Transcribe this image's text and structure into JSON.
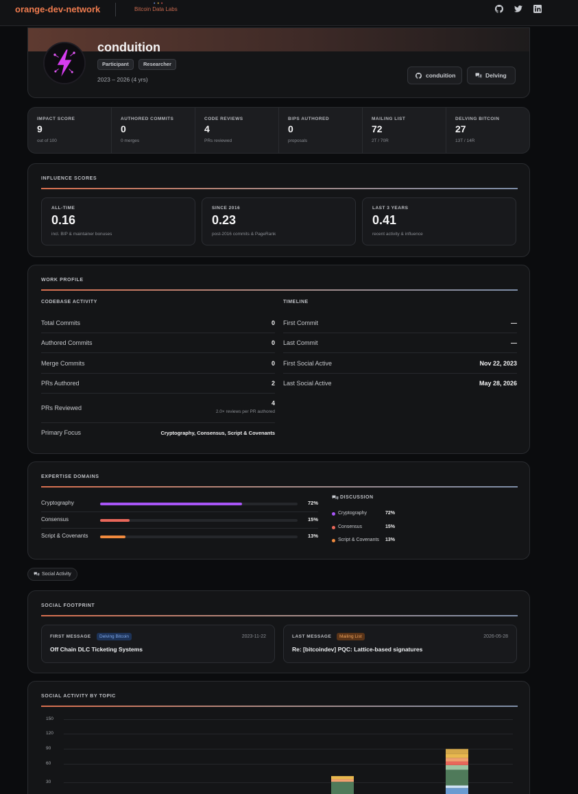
{
  "header": {
    "brand": "orange-dev-network",
    "partner_logo_text": "Bitcoin Data Labs",
    "icons": [
      "github-icon",
      "twitter-icon",
      "linkedin-icon"
    ]
  },
  "profile": {
    "name": "conduition",
    "tags": [
      "Participant",
      "Researcher"
    ],
    "active_range": "2023 – 2026 (4 yrs)",
    "links": [
      {
        "label": "conduition",
        "icon": "github-icon"
      },
      {
        "label": "Delving",
        "icon": "chat-bubbles-icon"
      }
    ]
  },
  "stats": [
    {
      "label": "IMPACT SCORE",
      "value": "9",
      "sub": "out of 100"
    },
    {
      "label": "AUTHORED COMMITS",
      "value": "0",
      "sub": "0 merges"
    },
    {
      "label": "CODE REVIEWS",
      "value": "4",
      "sub": "PRs reviewed"
    },
    {
      "label": "BIPS AUTHORED",
      "value": "0",
      "sub": "proposals"
    },
    {
      "label": "MAILING LIST",
      "value": "72",
      "sub": "2T / 70R"
    },
    {
      "label": "DELVING BITCOIN",
      "value": "27",
      "sub": "13T / 14R"
    }
  ],
  "influence": {
    "title": "INFLUENCE SCORES",
    "cards": [
      {
        "label": "ALL-TIME",
        "value": "0.16",
        "sub": "incl. BIP & maintainer bonuses"
      },
      {
        "label": "SINCE 2016",
        "value": "0.23",
        "sub": "post-2016 commits & PageRank"
      },
      {
        "label": "LAST 3 YEARS",
        "value": "0.41",
        "sub": "recent activity & influence"
      }
    ]
  },
  "work_profile": {
    "title": "WORK PROFILE",
    "codebase_title": "CODEBASE ACTIVITY",
    "timeline_title": "TIMELINE",
    "codebase": [
      {
        "label": "Total Commits",
        "value": "0"
      },
      {
        "label": "Authored Commits",
        "value": "0"
      },
      {
        "label": "Merge Commits",
        "value": "0"
      },
      {
        "label": "PRs Authored",
        "value": "2"
      },
      {
        "label": "PRs Reviewed",
        "value": "4",
        "note": "2.0× reviews per PR authored"
      },
      {
        "label": "Primary Focus",
        "value": "Cryptography, Consensus, Script & Covenants"
      }
    ],
    "timeline": [
      {
        "label": "First Commit",
        "value": "—"
      },
      {
        "label": "Last Commit",
        "value": "—"
      },
      {
        "label": "First Social Active",
        "value": "Nov 22, 2023"
      },
      {
        "label": "Last Social Active",
        "value": "May 28, 2026"
      }
    ]
  },
  "expertise": {
    "title": "EXPERTISE DOMAINS",
    "colors": [
      "#a855f7",
      "#e8675a",
      "#f08a3e"
    ],
    "domains": [
      {
        "label": "Cryptography",
        "pct": "72%",
        "fraction": 0.72
      },
      {
        "label": "Consensus",
        "pct": "15%",
        "fraction": 0.15
      },
      {
        "label": "Script & Covenants",
        "pct": "13%",
        "fraction": 0.13
      }
    ],
    "discussion_title": "DISCUSSION",
    "discussion": [
      {
        "label": "Cryptography",
        "pct": "72%"
      },
      {
        "label": "Consensus",
        "pct": "15%"
      },
      {
        "label": "Script & Covenants",
        "pct": "13%"
      }
    ]
  },
  "social_chip": "Social Activity",
  "social_footprint": {
    "title": "SOCIAL FOOTPRINT",
    "first": {
      "label": "FIRST MESSAGE",
      "badge": "Delving Bitcoin",
      "date": "2023-11-22",
      "title": "Off Chain DLC Ticketing Systems"
    },
    "last": {
      "label": "LAST MESSAGE",
      "badge": "Mailing List",
      "date": "2026-05-28",
      "title": "Re: [bitcoindev] PQC: Lattice-based signatures"
    }
  },
  "social_topics": {
    "title": "SOCIAL ACTIVITY BY TOPIC"
  },
  "chart_data": {
    "type": "bar",
    "stacked": true,
    "title": "SOCIAL ACTIVITY BY TOPIC",
    "ylim": [
      0,
      150
    ],
    "yticks": [
      30,
      60,
      90,
      120,
      150
    ],
    "grid": true,
    "stack_colors": [
      "#6a9bd1",
      "#cfe2f3",
      "#4f7a5a",
      "#9cc4a0",
      "#e8675a",
      "#f0a070",
      "#e8b84e",
      "#d4a84a"
    ],
    "bars": [
      {
        "segments": [
          {
            "value": 2,
            "color_index": 2
          }
        ]
      },
      {
        "segments": [
          {
            "value": 0,
            "color_index": 0
          },
          {
            "value": 5,
            "color_index": 1
          },
          {
            "value": 25,
            "color_index": 2
          },
          {
            "value": 5,
            "color_index": 5
          },
          {
            "value": 6,
            "color_index": 6
          }
        ]
      },
      {
        "segments": [
          {
            "value": 18,
            "color_index": 0
          },
          {
            "value": 5,
            "color_index": 1
          },
          {
            "value": 30,
            "color_index": 2
          },
          {
            "value": 9,
            "color_index": 3
          },
          {
            "value": 7,
            "color_index": 4
          },
          {
            "value": 7,
            "color_index": 5
          },
          {
            "value": 7,
            "color_index": 6
          },
          {
            "value": 10,
            "color_index": 7
          }
        ]
      }
    ]
  }
}
